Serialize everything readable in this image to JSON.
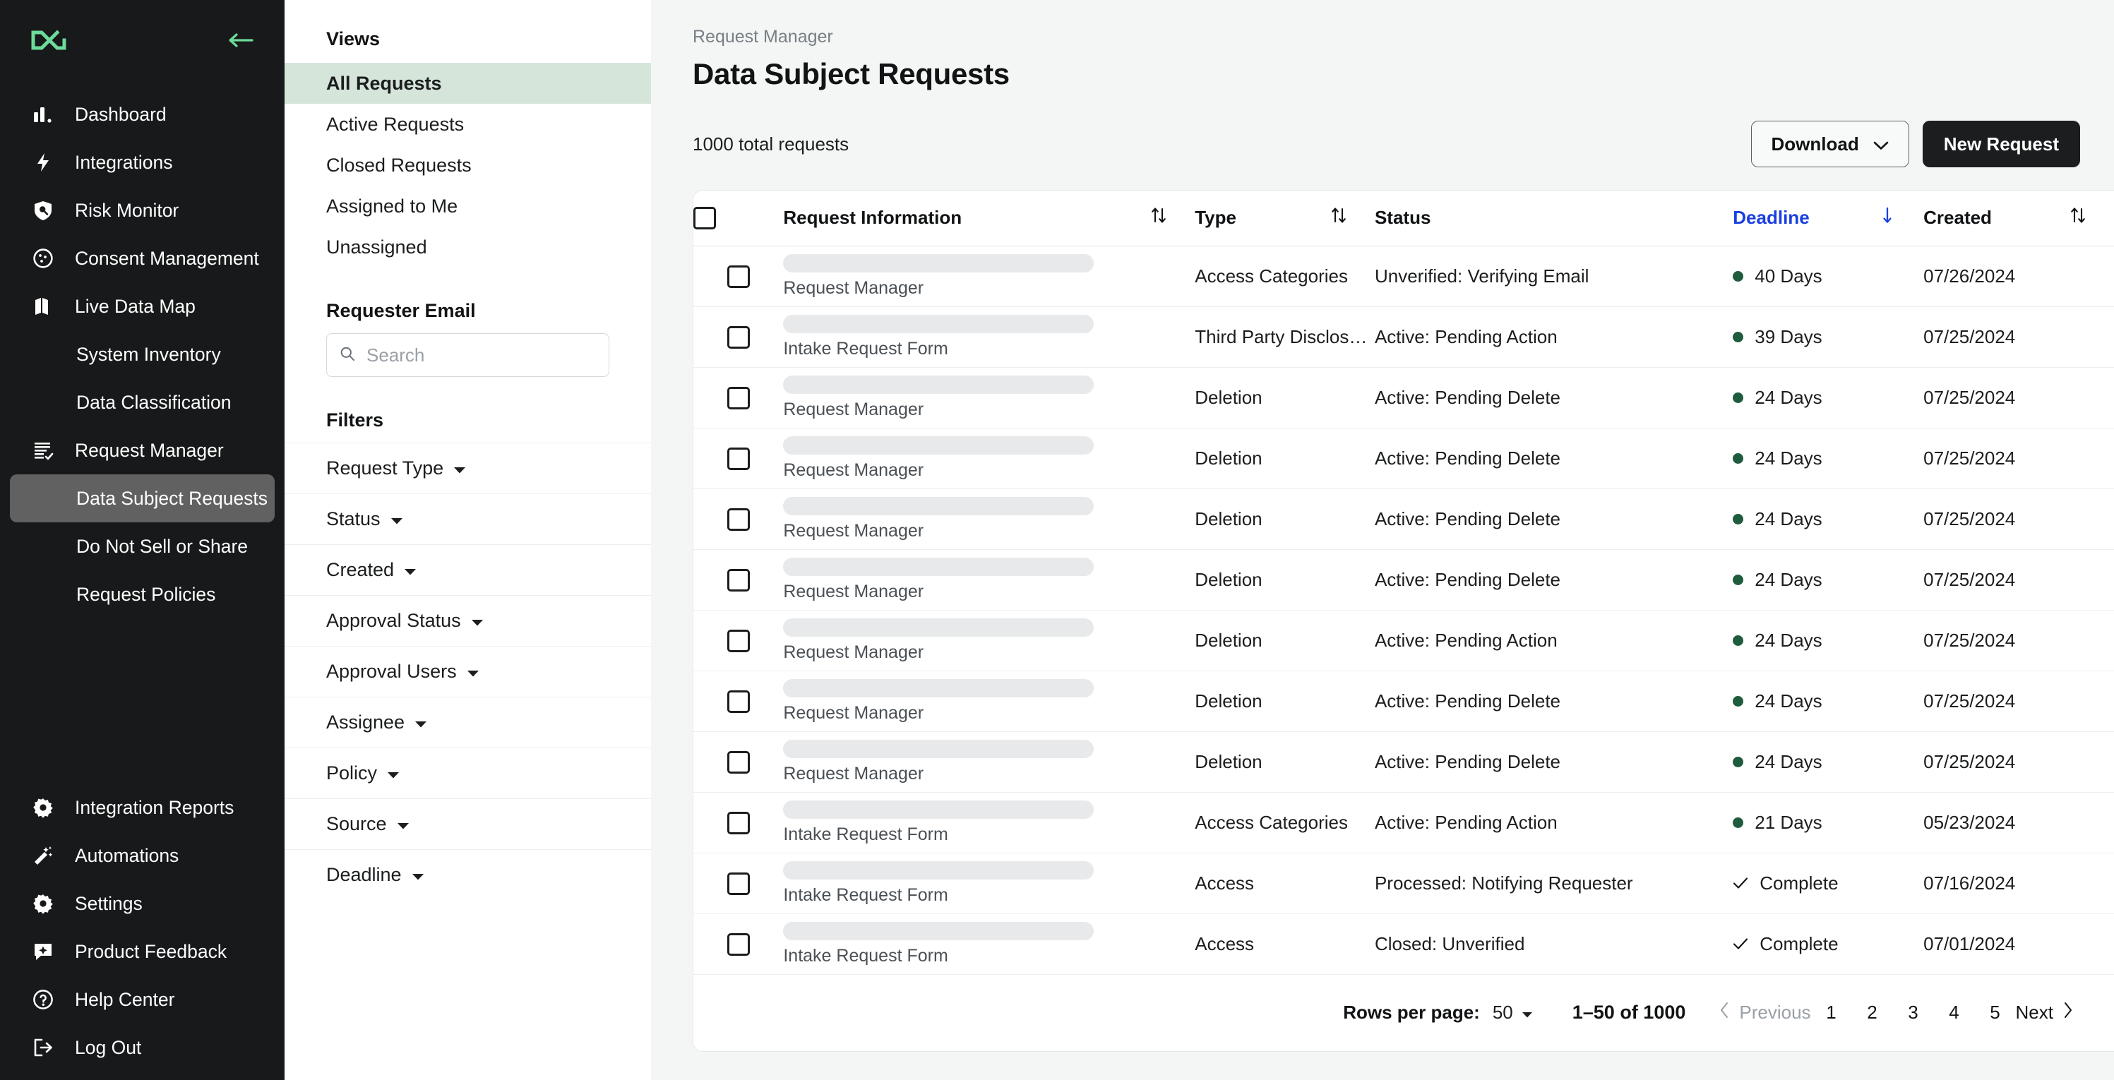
{
  "sidebar": {
    "logo_name": "transcend-logo",
    "collapse_label": "collapse-sidebar",
    "items": [
      {
        "label": "Dashboard",
        "icon": "bar-chart-icon",
        "sub": false,
        "active": false
      },
      {
        "label": "Integrations",
        "icon": "lightning-bolt-icon",
        "sub": false,
        "active": false
      },
      {
        "label": "Risk Monitor",
        "icon": "shield-search-icon",
        "sub": false,
        "active": false
      },
      {
        "label": "Consent Management",
        "icon": "cookie-icon",
        "sub": false,
        "active": false
      },
      {
        "label": "Live Data Map",
        "icon": "map-icon",
        "sub": false,
        "active": false
      },
      {
        "label": "System Inventory",
        "icon": "none",
        "sub": true,
        "active": false
      },
      {
        "label": "Data Classification",
        "icon": "none",
        "sub": true,
        "active": false
      },
      {
        "label": "Request Manager",
        "icon": "checklist-icon",
        "sub": false,
        "active": false
      },
      {
        "label": "Data Subject Requests",
        "icon": "none",
        "sub": true,
        "active": true
      },
      {
        "label": "Do Not Sell or Share",
        "icon": "none",
        "sub": true,
        "active": false
      },
      {
        "label": "Request Policies",
        "icon": "none",
        "sub": true,
        "active": false
      }
    ],
    "bottom_items": [
      {
        "label": "Integration Reports",
        "icon": "gear-icon"
      },
      {
        "label": "Automations",
        "icon": "magic-wand-icon"
      },
      {
        "label": "Settings",
        "icon": "gear-icon"
      },
      {
        "label": "Product Feedback",
        "icon": "chat-sparkle-icon"
      },
      {
        "label": "Help Center",
        "icon": "question-circle-icon"
      },
      {
        "label": "Log Out",
        "icon": "logout-icon"
      }
    ],
    "accent_color": "#6ddc9b",
    "background_color": "#17191a",
    "active_item_color": "#616161"
  },
  "views_panel": {
    "views_heading": "Views",
    "views": [
      {
        "label": "All Requests",
        "active": true
      },
      {
        "label": "Active Requests",
        "active": false
      },
      {
        "label": "Closed Requests",
        "active": false
      },
      {
        "label": "Assigned to Me",
        "active": false
      },
      {
        "label": "Unassigned",
        "active": false
      }
    ],
    "active_view_bg": "#d5e5da",
    "requester_email_heading": "Requester Email",
    "search_placeholder": "Search",
    "search_value": "",
    "filters_heading": "Filters",
    "filters": [
      {
        "label": "Request Type"
      },
      {
        "label": "Status"
      },
      {
        "label": "Created"
      },
      {
        "label": "Approval Status"
      },
      {
        "label": "Approval Users"
      },
      {
        "label": "Assignee"
      },
      {
        "label": "Policy"
      },
      {
        "label": "Source"
      },
      {
        "label": "Deadline"
      }
    ]
  },
  "header": {
    "breadcrumb": "Request Manager",
    "title": "Data Subject Requests",
    "total_requests": "1000 total requests",
    "download_label": "Download",
    "new_request_label": "New Request"
  },
  "table": {
    "columns": [
      {
        "key": "checkbox",
        "label": "",
        "sortable": false,
        "sorted": "none"
      },
      {
        "key": "info",
        "label": "Request Information",
        "sortable": true,
        "sorted": "none"
      },
      {
        "key": "type",
        "label": "Type",
        "sortable": true,
        "sorted": "none"
      },
      {
        "key": "status",
        "label": "Status",
        "sortable": false,
        "sorted": "none"
      },
      {
        "key": "deadline",
        "label": "Deadline",
        "sortable": true,
        "sorted": "desc"
      },
      {
        "key": "created",
        "label": "Created",
        "sortable": true,
        "sorted": "none"
      }
    ],
    "sorted_column_color": "#1a3fe0",
    "status_dot_color": "#1f5c3d",
    "rows": [
      {
        "redacted": true,
        "source": "Request Manager",
        "type": "Access Categories",
        "status": "Unverified: Verifying Email",
        "deadline": "40 Days",
        "deadline_kind": "dot",
        "created": "07/26/2024"
      },
      {
        "redacted": true,
        "source": "Intake Request Form",
        "type": "Third Party Disclos…",
        "status": "Active: Pending Action",
        "deadline": "39 Days",
        "deadline_kind": "dot",
        "created": "07/25/2024"
      },
      {
        "redacted": true,
        "source": "Request Manager",
        "type": "Deletion",
        "status": "Active: Pending Delete",
        "deadline": "24 Days",
        "deadline_kind": "dot",
        "created": "07/25/2024"
      },
      {
        "redacted": true,
        "source": "Request Manager",
        "type": "Deletion",
        "status": "Active: Pending Delete",
        "deadline": "24 Days",
        "deadline_kind": "dot",
        "created": "07/25/2024"
      },
      {
        "redacted": true,
        "source": "Request Manager",
        "type": "Deletion",
        "status": "Active: Pending Delete",
        "deadline": "24 Days",
        "deadline_kind": "dot",
        "created": "07/25/2024"
      },
      {
        "redacted": true,
        "source": "Request Manager",
        "type": "Deletion",
        "status": "Active: Pending Delete",
        "deadline": "24 Days",
        "deadline_kind": "dot",
        "created": "07/25/2024"
      },
      {
        "redacted": true,
        "source": "Request Manager",
        "type": "Deletion",
        "status": "Active: Pending Action",
        "deadline": "24 Days",
        "deadline_kind": "dot",
        "created": "07/25/2024"
      },
      {
        "redacted": true,
        "source": "Request Manager",
        "type": "Deletion",
        "status": "Active: Pending Delete",
        "deadline": "24 Days",
        "deadline_kind": "dot",
        "created": "07/25/2024"
      },
      {
        "redacted": true,
        "source": "Request Manager",
        "type": "Deletion",
        "status": "Active: Pending Delete",
        "deadline": "24 Days",
        "deadline_kind": "dot",
        "created": "07/25/2024"
      },
      {
        "redacted": true,
        "source": "Intake Request Form",
        "type": "Access Categories",
        "status": "Active: Pending Action",
        "deadline": "21 Days",
        "deadline_kind": "dot",
        "created": "05/23/2024"
      },
      {
        "redacted": true,
        "source": "Intake Request Form",
        "type": "Access",
        "status": "Processed: Notifying Requester",
        "deadline": "Complete",
        "deadline_kind": "check",
        "created": "07/16/2024"
      },
      {
        "redacted": true,
        "source": "Intake Request Form",
        "type": "Access",
        "status": "Closed: Unverified",
        "deadline": "Complete",
        "deadline_kind": "check",
        "created": "07/01/2024"
      }
    ]
  },
  "pagination": {
    "rows_per_page_label": "Rows per page:",
    "rows_per_page_value": "50",
    "range_label": "1–50 of 1000",
    "previous_label": "Previous",
    "next_label": "Next",
    "pages": [
      "1",
      "2",
      "3",
      "4",
      "5"
    ],
    "current_page": "1"
  }
}
